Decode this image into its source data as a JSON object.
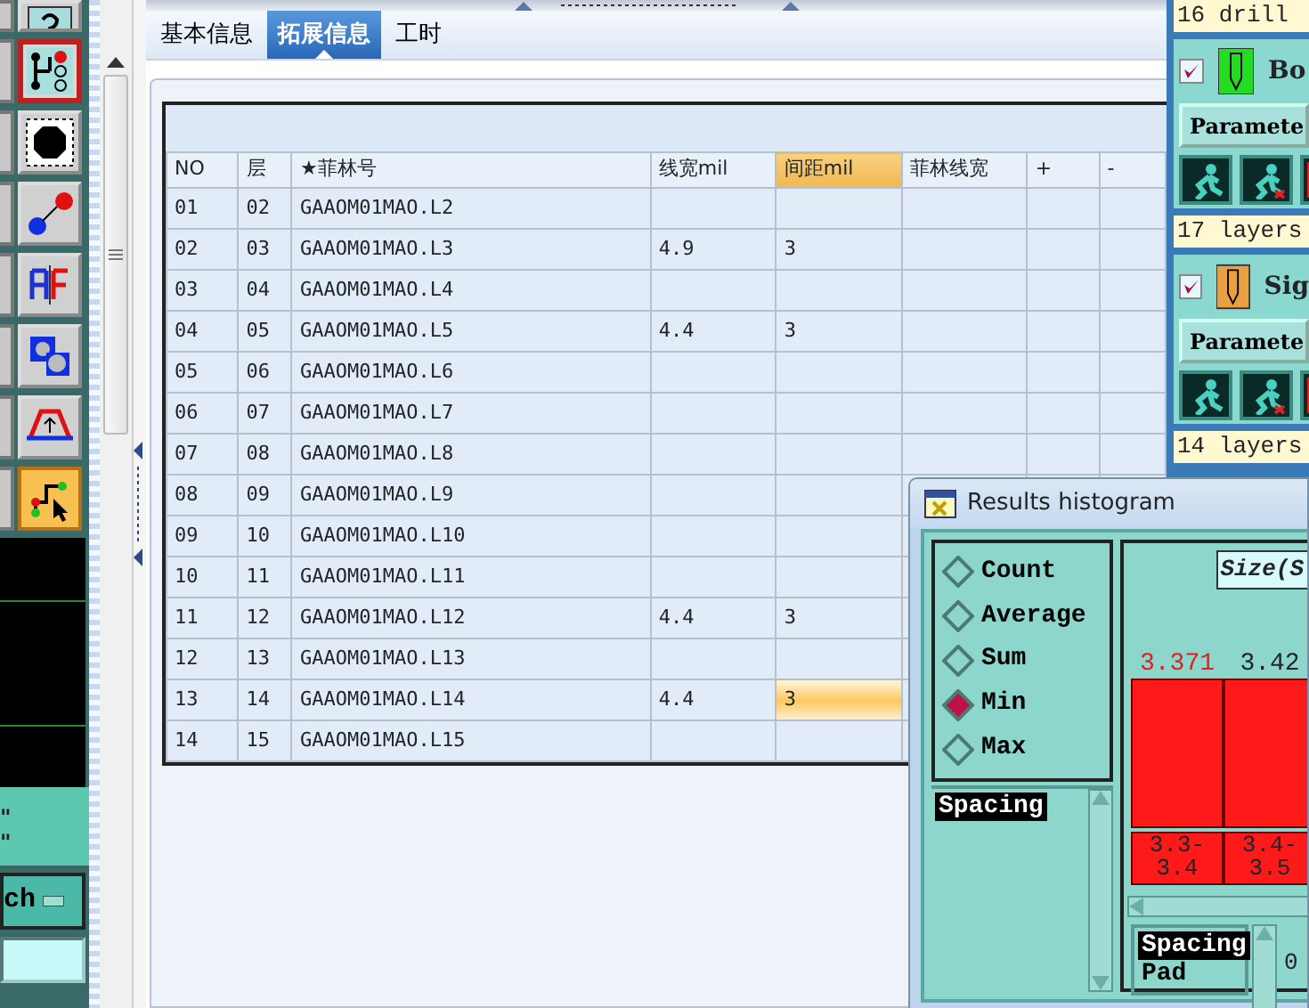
{
  "tools": [
    {
      "kind": "help",
      "selected": false
    },
    {
      "kind": "netlist",
      "selected": true
    },
    {
      "kind": "pad",
      "selected": false
    },
    {
      "kind": "connect",
      "selected": false
    },
    {
      "kind": "split",
      "selected": false
    },
    {
      "kind": "shapes",
      "selected": false
    },
    {
      "kind": "bridge",
      "selected": false
    },
    {
      "kind": "route",
      "selected": true
    }
  ],
  "left_panel": {
    "lines": [
      "\"",
      "\""
    ],
    "button": "ch"
  },
  "tabs": [
    {
      "label": "基本信息",
      "selected": false
    },
    {
      "label": "拓展信息",
      "selected": true
    },
    {
      "label": "工时",
      "selected": false
    }
  ],
  "table": {
    "columns": [
      {
        "label": "NO",
        "selected": false
      },
      {
        "label": "层",
        "selected": false
      },
      {
        "label": "★菲林号",
        "selected": false
      },
      {
        "label": "线宽mil",
        "selected": false
      },
      {
        "label": "间距mil",
        "selected": true
      },
      {
        "label": "菲林线宽",
        "selected": false
      },
      {
        "label": "+",
        "selected": false
      },
      {
        "label": "-",
        "selected": false
      }
    ],
    "rows": [
      {
        "cells": [
          "01",
          "02",
          "GAAOM01MAO.L2",
          "",
          ""
        ],
        "selected": false
      },
      {
        "cells": [
          "02",
          "03",
          "GAAOM01MAO.L3",
          "4.9",
          "3"
        ],
        "selected": false
      },
      {
        "cells": [
          "03",
          "04",
          "GAAOM01MAO.L4",
          "",
          ""
        ],
        "selected": false
      },
      {
        "cells": [
          "04",
          "05",
          "GAAOM01MAO.L5",
          "4.4",
          "3"
        ],
        "selected": false
      },
      {
        "cells": [
          "05",
          "06",
          "GAAOM01MAO.L6",
          "",
          ""
        ],
        "selected": false
      },
      {
        "cells": [
          "06",
          "07",
          "GAAOM01MAO.L7",
          "",
          ""
        ],
        "selected": false
      },
      {
        "cells": [
          "07",
          "08",
          "GAAOM01MAO.L8",
          "",
          ""
        ],
        "selected": false
      },
      {
        "cells": [
          "08",
          "09",
          "GAAOM01MAO.L9",
          "",
          ""
        ],
        "selected": false
      },
      {
        "cells": [
          "09",
          "10",
          "GAAOM01MAO.L10",
          "",
          ""
        ],
        "selected": false
      },
      {
        "cells": [
          "10",
          "11",
          "GAAOM01MAO.L11",
          "",
          ""
        ],
        "selected": false
      },
      {
        "cells": [
          "11",
          "12",
          "GAAOM01MAO.L12",
          "4.4",
          "3"
        ],
        "selected": false
      },
      {
        "cells": [
          "12",
          "13",
          "GAAOM01MAO.L13",
          "",
          ""
        ],
        "selected": false
      },
      {
        "cells": [
          "13",
          "14",
          "GAAOM01MAO.L14",
          "4.4",
          "3"
        ],
        "selected": true
      },
      {
        "cells": [
          "14",
          "15",
          "GAAOM01MAO.L15",
          "",
          ""
        ],
        "selected": false
      }
    ]
  },
  "layers_panel": {
    "items": [
      {
        "kind": "count",
        "text": "16 drill"
      },
      {
        "kind": "layer",
        "name": "Bo",
        "checked": true,
        "color": "#22dd22",
        "button": "Paramete"
      },
      {
        "kind": "count",
        "text": "17 layers"
      },
      {
        "kind": "layer",
        "name": "Sig",
        "checked": true,
        "color": "#e8a040",
        "button": "Paramete"
      },
      {
        "kind": "count",
        "text": "14 layers"
      }
    ]
  },
  "histogram_window": {
    "title": "Results histogram",
    "modes": [
      {
        "label": "Count",
        "selected": false
      },
      {
        "label": "Average",
        "selected": false
      },
      {
        "label": "Sum",
        "selected": false
      },
      {
        "label": "Min",
        "selected": true
      },
      {
        "label": "Max",
        "selected": false
      }
    ],
    "list": [
      {
        "label": "Spacing",
        "selected": true
      }
    ],
    "chart_title": "Size(S",
    "bins": [
      {
        "value": "3.371",
        "highlighted": true,
        "range": "3.3-3.4"
      },
      {
        "value": "3.42",
        "highlighted": false,
        "range": "3.4-3.5"
      }
    ],
    "bottom_list": [
      {
        "label": "Spacing",
        "selected": true
      },
      {
        "label": "Pad",
        "selected": false
      }
    ],
    "column_3": "0"
  }
}
